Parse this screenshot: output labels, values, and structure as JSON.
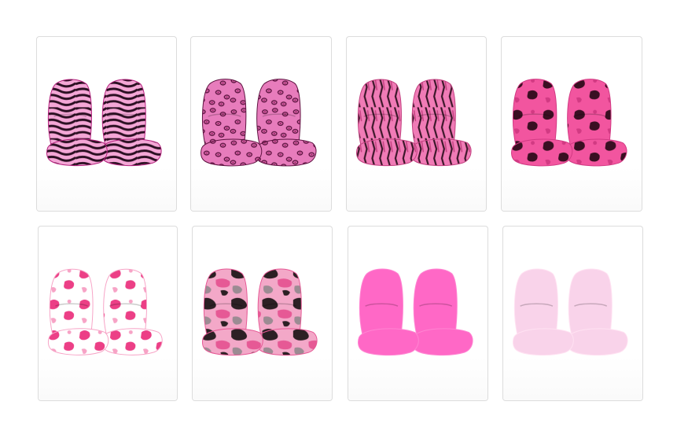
{
  "products": [
    {
      "pattern": "zebra",
      "base": "#f4a6d6",
      "mark": "#2b0f22",
      "mark2": "#b5227e"
    },
    {
      "pattern": "leopard",
      "base": "#e77cbc",
      "mark": "#a12a6c",
      "mark2": "#5e1240"
    },
    {
      "pattern": "tiger",
      "base": "#f07bb6",
      "mark": "#3a1628",
      "mark2": "#c2407f"
    },
    {
      "pattern": "cow",
      "base": "#f2559f",
      "mark": "#3a0f22",
      "mark2": "#d23a83"
    },
    {
      "pattern": "cow",
      "base": "#ffffff",
      "mark": "#ec3f86",
      "mark2": "#f7a3c6"
    },
    {
      "pattern": "camo",
      "base": "#f3a8c8",
      "mark": "#2c2024",
      "mark2": "#e65995"
    },
    {
      "pattern": "solid",
      "base": "#ff68c6",
      "mark": "#e74bb0",
      "mark2": "#ff85d2"
    },
    {
      "pattern": "solid",
      "base": "#f9d3ea",
      "mark": "#ebb7d6",
      "mark2": "#ffe2f2"
    }
  ]
}
